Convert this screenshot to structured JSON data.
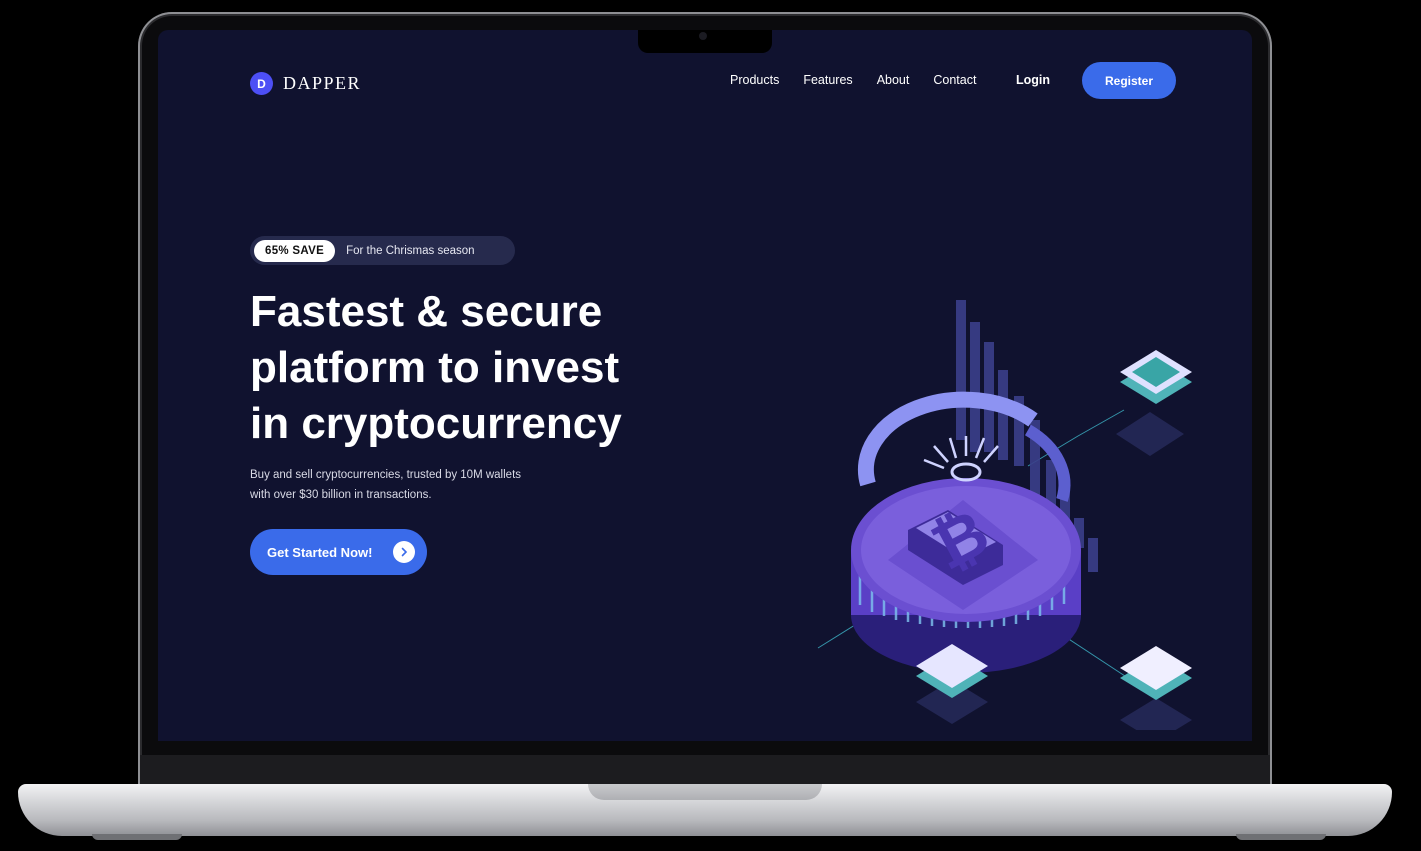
{
  "brand": {
    "name": "DAPPER",
    "mark": "D"
  },
  "nav": {
    "items": [
      {
        "label": "Products"
      },
      {
        "label": "Features"
      },
      {
        "label": "About"
      },
      {
        "label": "Contact"
      }
    ],
    "login_label": "Login",
    "register_label": "Register"
  },
  "hero": {
    "promo_badge": "65% SAVE",
    "promo_text": "For the Chrismas season",
    "headline_lines": [
      "Fastest & secure",
      "platform to invest",
      "in cryptocurrency"
    ],
    "description_lines": [
      "Buy and sell cryptocurrencies, trusted by 10M wallets",
      "with over $30 billion in transactions."
    ],
    "cta_label": "Get Started Now!",
    "cta_icon": "chevron-right-icon"
  },
  "illustration": {
    "icon": "bitcoin-coin-illustration"
  },
  "colors": {
    "screen_bg": "#10122f",
    "accent": "#3a6bea",
    "logo": "#4d4ff5",
    "promo_bg": "#262a4d",
    "coin": "#6a4fd0"
  }
}
